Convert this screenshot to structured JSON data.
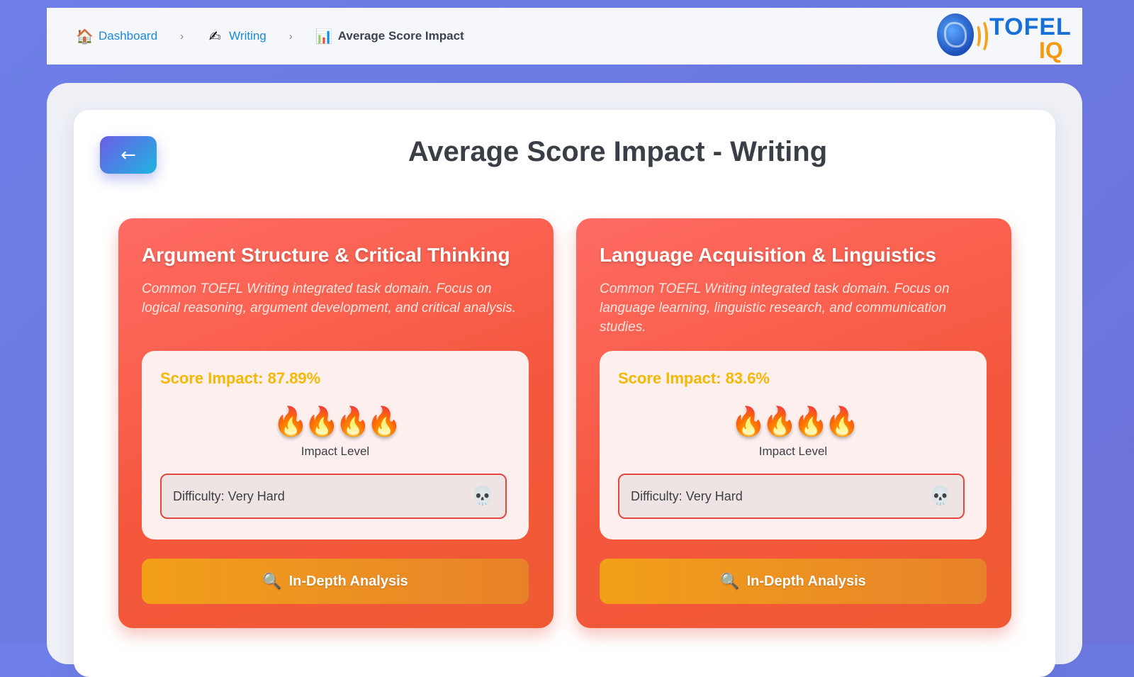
{
  "breadcrumb": {
    "items": [
      {
        "label": "Dashboard",
        "icon": "home-icon",
        "glyph": "🏠"
      },
      {
        "label": "Writing",
        "icon": "pencil-icon",
        "glyph": "✍"
      },
      {
        "label": "Average Score Impact",
        "icon": "bar-chart-icon",
        "glyph": "📊"
      }
    ],
    "separator": "›"
  },
  "logo": {
    "primary": "TOFEL",
    "secondary": "IQ"
  },
  "page": {
    "title": "Average Score Impact - Writing",
    "back_label": "←"
  },
  "cards": [
    {
      "title": "Argument Structure & Critical Thinking",
      "description": "Common TOEFL Writing integrated task domain. Focus on logical reasoning, argument development, and critical analysis.",
      "score_impact": "Score Impact: 87.89%",
      "impact_level_label": "Impact Level",
      "impact_level_count": 4,
      "impact_glyph": "🔥🔥🔥🔥",
      "difficulty": "Difficulty: Very Hard",
      "difficulty_glyph": "💀",
      "button_label": "In-Depth Analysis",
      "button_glyph": "🔍"
    },
    {
      "title": "Language Acquisition & Linguistics",
      "description": "Common TOEFL Writing integrated task domain. Focus on language learning, linguistic research, and communication studies.",
      "score_impact": "Score Impact: 83.6%",
      "impact_level_label": "Impact Level",
      "impact_level_count": 4,
      "impact_glyph": "🔥🔥🔥🔥",
      "difficulty": "Difficulty: Very Hard",
      "difficulty_glyph": "💀",
      "button_label": "In-Depth Analysis",
      "button_glyph": "🔍"
    }
  ],
  "colors": {
    "background": "#6d7ae2",
    "card_gradient_start": "#ff6b63",
    "card_gradient_end": "#ef5a32",
    "score_text": "#f5b800",
    "difficulty_border": "#e5473c",
    "button_start": "#f2a01a",
    "button_end": "#e8822a",
    "link": "#1a8ad8"
  }
}
